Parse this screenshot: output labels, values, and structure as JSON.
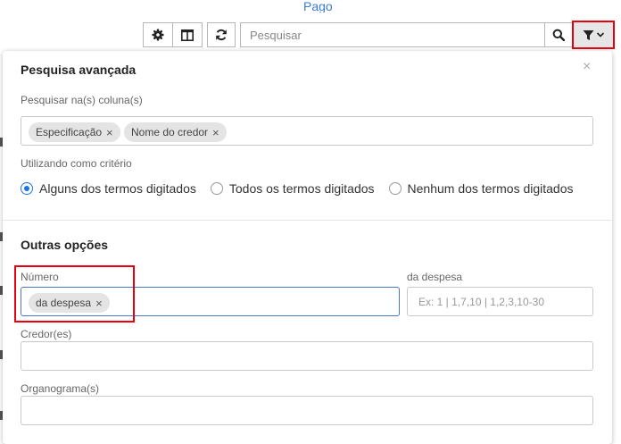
{
  "top_link": "Pago",
  "toolbar": {
    "search_placeholder": "Pesquisar"
  },
  "panel": {
    "title": "Pesquisa avançada",
    "close_symbol": "×",
    "columns_label": "Pesquisar na(s) coluna(s)",
    "column_chips": [
      "Especificação",
      "Nome do credor"
    ],
    "chip_remove_symbol": "×",
    "criteria_label": "Utilizando como critério",
    "criteria_options": [
      {
        "label": "Alguns dos termos digitados",
        "selected": true
      },
      {
        "label": "Todos os termos digitados",
        "selected": false
      },
      {
        "label": "Nenhum dos termos digitados",
        "selected": false
      }
    ],
    "other_title": "Outras opções",
    "numero_label": "Número",
    "numero_chip": "da despesa",
    "despesa_label": "da despesa",
    "despesa_placeholder": "Ex: 1 | 1,7,10 | 1,2,3,10-30",
    "credor_label": "Credor(es)",
    "organograma_label": "Organograma(s)"
  },
  "colors": {
    "accent": "#1e73e8",
    "highlight": "#e8000f",
    "link": "#3a7bd5"
  }
}
